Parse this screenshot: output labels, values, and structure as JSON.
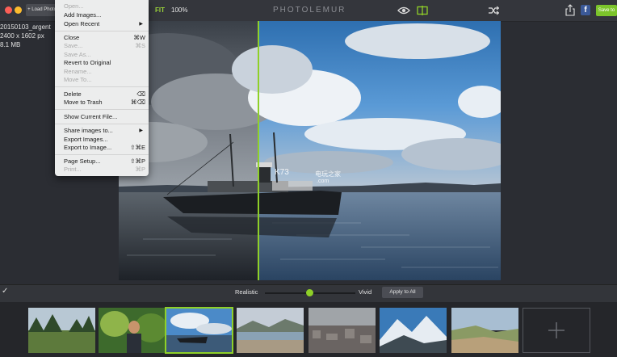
{
  "toolbar": {
    "load_label": "+ Load Photo",
    "fit_label": "FIT",
    "zoom_label": "100%",
    "app_title": "PHOTOLEMUR",
    "save_label": "Save to"
  },
  "file_info": {
    "name": "20150103_argent",
    "dimensions": "2400 x 1602  px",
    "size": "8.1 MB"
  },
  "menu": {
    "items": [
      {
        "label": "Open...",
        "shortcut": "",
        "disabled": true
      },
      {
        "label": "Add Images...",
        "shortcut": "",
        "disabled": false
      },
      {
        "label": "Open Recent",
        "shortcut": "",
        "disabled": false,
        "submenu": true
      },
      {
        "label": "Close",
        "shortcut": "⌘W",
        "disabled": false
      },
      {
        "label": "Save...",
        "shortcut": "⌘S",
        "disabled": true
      },
      {
        "label": "Save As...",
        "shortcut": "",
        "disabled": true
      },
      {
        "label": "Revert to Original",
        "shortcut": "",
        "disabled": false
      },
      {
        "label": "Rename...",
        "shortcut": "",
        "disabled": true
      },
      {
        "label": "Move To...",
        "shortcut": "",
        "disabled": true
      },
      {
        "label": "Delete",
        "shortcut": "⌫",
        "disabled": false
      },
      {
        "label": "Move to Trash",
        "shortcut": "⌘⌫",
        "disabled": false
      },
      {
        "label": "Show Current File...",
        "shortcut": "",
        "disabled": false
      },
      {
        "label": "Share images to...",
        "shortcut": "",
        "disabled": false,
        "submenu": true
      },
      {
        "label": "Export Images...",
        "shortcut": "",
        "disabled": false
      },
      {
        "label": "Export to Image...",
        "shortcut": "⇧⌘E",
        "disabled": false
      },
      {
        "label": "Page Setup...",
        "shortcut": "⇧⌘P",
        "disabled": false
      },
      {
        "label": "Print...",
        "shortcut": "⌘P",
        "disabled": true
      }
    ]
  },
  "watermark": {
    "logo": "K73",
    "text": "电玩之家",
    "domain": ".com"
  },
  "adjust": {
    "left_label": "Realistic",
    "right_label": "Vivid",
    "strength": 0.5,
    "apply_label": "Apply to All"
  },
  "colors": {
    "accent": "#8fd028",
    "save_green": "#7cc42b"
  },
  "icons": [
    "eye-icon",
    "compare-icon",
    "shuffle-icon",
    "share-icon",
    "facebook-icon",
    "check-icon",
    "add-icon"
  ],
  "thumbnails": [
    {
      "name": "thumb-meadow-trees",
      "selected": false
    },
    {
      "name": "thumb-woman-forest",
      "selected": false
    },
    {
      "name": "thumb-ship-harbor",
      "selected": true
    },
    {
      "name": "thumb-coastal-city",
      "selected": false
    },
    {
      "name": "thumb-city-dusk",
      "selected": false
    },
    {
      "name": "thumb-snowy-mountains",
      "selected": false
    },
    {
      "name": "thumb-rocky-coast",
      "selected": false
    }
  ]
}
